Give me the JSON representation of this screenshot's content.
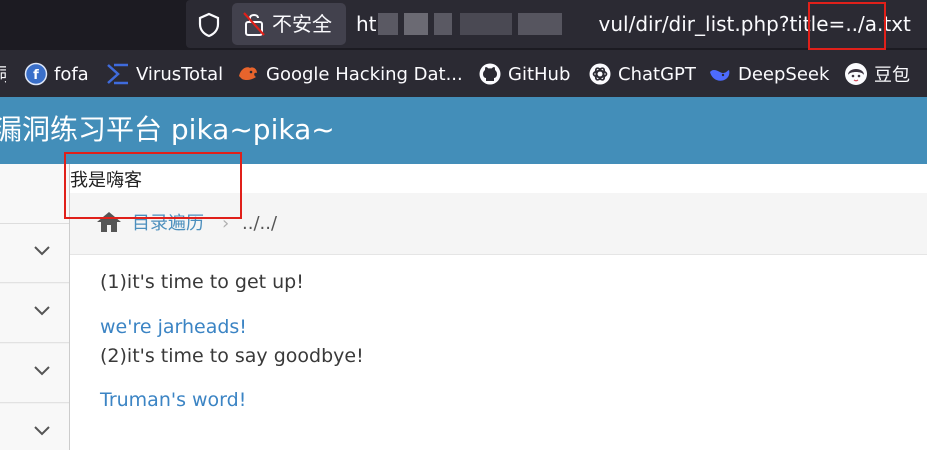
{
  "browser": {
    "security_label": "不安全",
    "url_prefix": "ht",
    "url_path": "vul/dir/dir_list.php?title=",
    "url_param": "../a.txt"
  },
  "bookmarks": [
    {
      "label": "fofa",
      "icon": "fofa-icon"
    },
    {
      "label": "VirusTotal",
      "icon": "virustotal-icon"
    },
    {
      "label": "Google Hacking Dat...",
      "icon": "exploit-db-icon"
    },
    {
      "label": "GitHub",
      "icon": "github-icon"
    },
    {
      "label": "ChatGPT",
      "icon": "chatgpt-icon"
    },
    {
      "label": "DeepSeek",
      "icon": "deepseek-icon"
    },
    {
      "label": "豆包",
      "icon": "doubao-icon"
    }
  ],
  "header": {
    "brand": "漏洞练习平台 pika~pika~"
  },
  "page": {
    "hacker_text": "我是嗨客",
    "breadcrumb": {
      "link": "目录遍历",
      "separator": "›",
      "current": "../../"
    },
    "lines": [
      {
        "text": "(1)it's time to get up!",
        "style": "dark"
      },
      {
        "text": "we're jarheads!",
        "style": "link"
      },
      {
        "text": "(2)it's time to say goodbye!",
        "style": "dark"
      },
      {
        "text": "Truman's word!",
        "style": "link"
      }
    ]
  },
  "colors": {
    "header_bg": "#438eb9",
    "link": "#3b84c4",
    "highlight": "#e0201a"
  }
}
